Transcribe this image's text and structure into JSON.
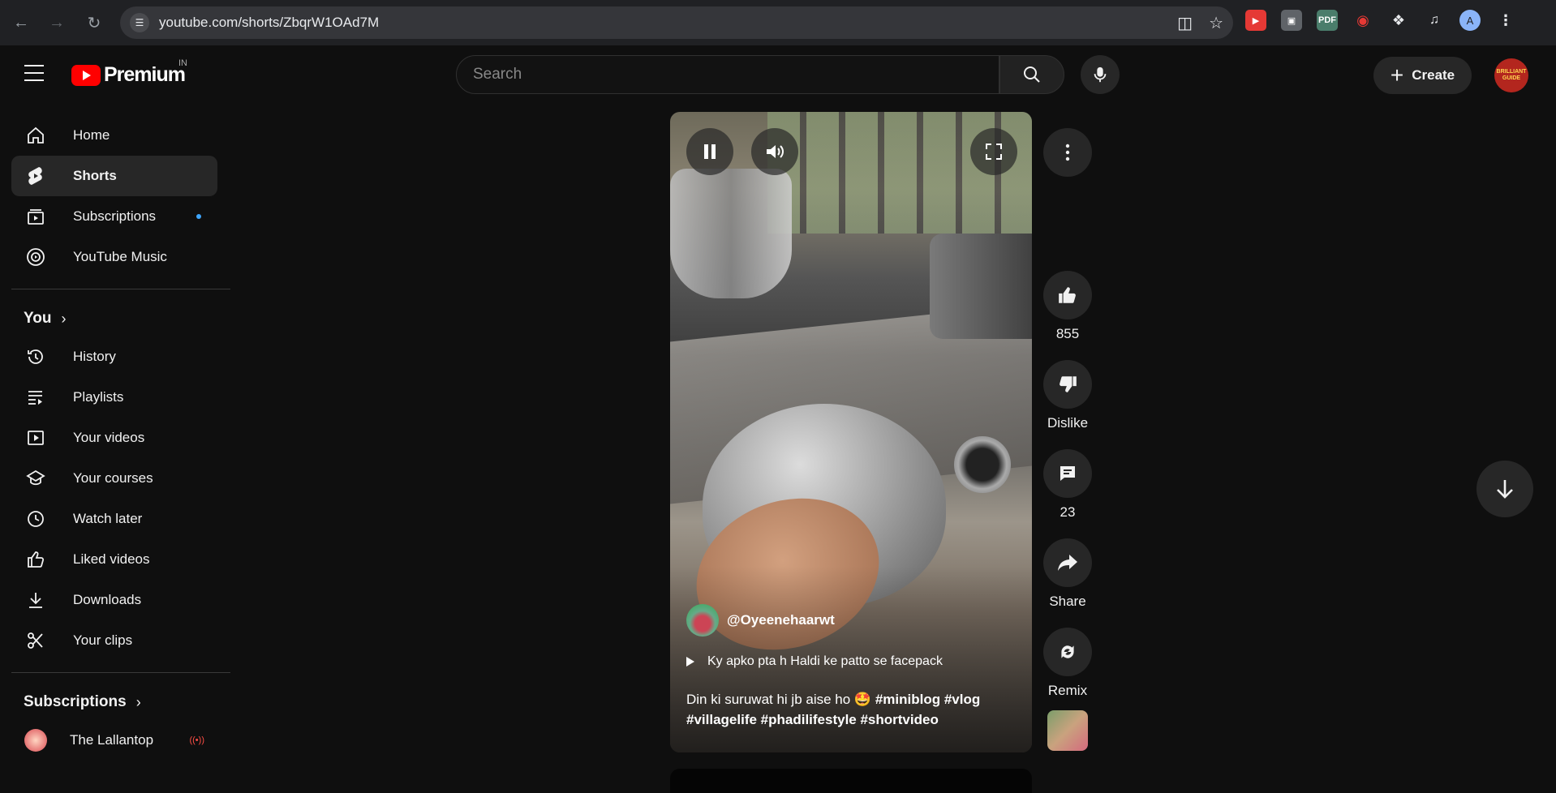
{
  "browser": {
    "url": "youtube.com/shorts/ZbqrW1OAd7M"
  },
  "header": {
    "logo_text": "Premium",
    "country_code": "IN",
    "search_placeholder": "Search",
    "create_label": "Create",
    "avatar_text": "BRILLIANT GUIDE"
  },
  "sidebar": {
    "main_items": [
      {
        "label": "Home",
        "icon": "home-icon"
      },
      {
        "label": "Shorts",
        "icon": "shorts-icon",
        "active": true
      },
      {
        "label": "Subscriptions",
        "icon": "subscriptions-icon",
        "has_dot": true
      },
      {
        "label": "YouTube Music",
        "icon": "youtube-music-icon"
      }
    ],
    "you_title": "You",
    "you_items": [
      {
        "label": "History",
        "icon": "history-icon"
      },
      {
        "label": "Playlists",
        "icon": "playlists-icon"
      },
      {
        "label": "Your videos",
        "icon": "your-videos-icon"
      },
      {
        "label": "Your courses",
        "icon": "courses-icon"
      },
      {
        "label": "Watch later",
        "icon": "clock-icon"
      },
      {
        "label": "Liked videos",
        "icon": "thumbs-up-icon"
      },
      {
        "label": "Downloads",
        "icon": "download-icon"
      },
      {
        "label": "Your clips",
        "icon": "scissors-icon"
      }
    ],
    "subscriptions_title": "Subscriptions",
    "subscriptions": [
      {
        "label": "The Lallantop",
        "live": true
      }
    ]
  },
  "short": {
    "channel_handle": "@Oyeenehaarwt",
    "music_title": "Ky apko pta h Haldi ke patto se facepack",
    "caption_text": "Din ki suruwat hi jb aise ho 🤩 ",
    "caption_tags": "#miniblog #vlog #villagelife #phadilifestyle #shortvideo"
  },
  "actions": {
    "like_count": "855",
    "dislike_label": "Dislike",
    "comment_count": "23",
    "share_label": "Share",
    "remix_label": "Remix"
  },
  "colors": {
    "brand_red": "#ff0000",
    "background": "#0f0f0f",
    "surface": "#272727",
    "notification_dot": "#3ea6ff",
    "live_red": "#ff4e45"
  }
}
